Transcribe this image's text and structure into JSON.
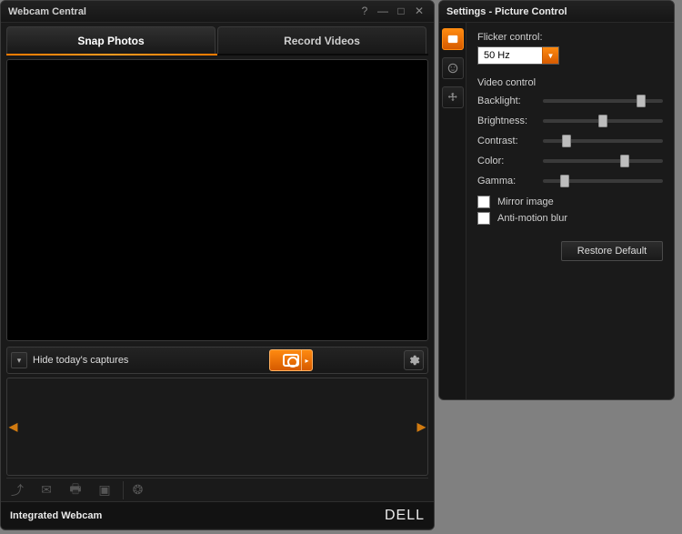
{
  "window": {
    "title": "Webcam Central",
    "tabs": [
      {
        "label": "Snap Photos",
        "active": true
      },
      {
        "label": "Record Videos",
        "active": false
      }
    ],
    "hide_captures_label": "Hide today's captures",
    "device_label": "Integrated Webcam",
    "brand": "DELL"
  },
  "settings": {
    "title": "Settings - Picture Control",
    "flicker_label": "Flicker control:",
    "flicker_value": "50 Hz",
    "video_heading": "Video control",
    "sliders": {
      "backlight": {
        "label": "Backlight:",
        "pct": 82
      },
      "brightness": {
        "label": "Brightness:",
        "pct": 50
      },
      "contrast": {
        "label": "Contrast:",
        "pct": 20
      },
      "color": {
        "label": "Color:",
        "pct": 68
      },
      "gamma": {
        "label": "Gamma:",
        "pct": 18
      }
    },
    "mirror_label": "Mirror image",
    "antimotion_label": "Anti-motion blur",
    "restore_label": "Restore Default"
  },
  "icons": {
    "help": "?",
    "minimize": "—",
    "maximize": "□",
    "close": "✕"
  }
}
